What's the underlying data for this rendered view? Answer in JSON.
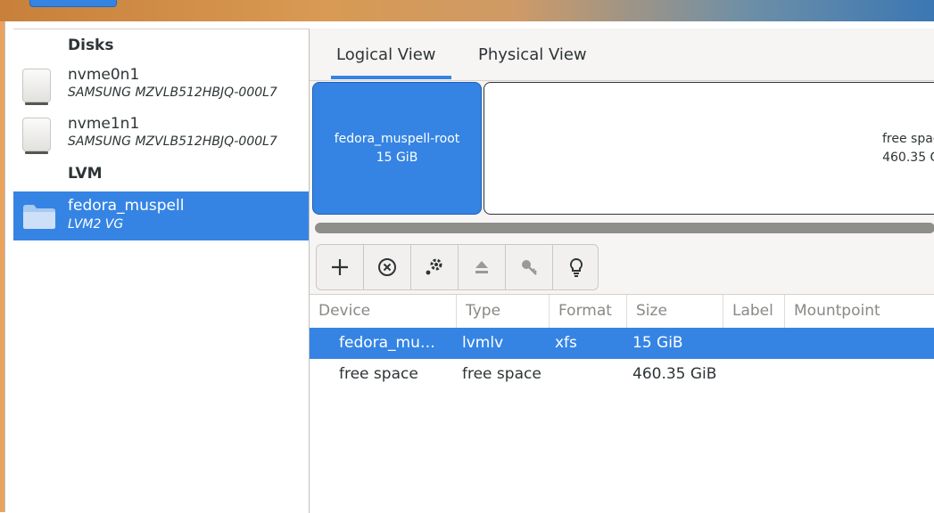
{
  "sidebar": {
    "disks_header": "Disks",
    "lvm_header": "LVM",
    "disks": [
      {
        "name": "nvme0n1",
        "model": "SAMSUNG MZVLB512HBJQ-000L7"
      },
      {
        "name": "nvme1n1",
        "model": "SAMSUNG MZVLB512HBJQ-000L7"
      }
    ],
    "volume_groups": [
      {
        "name": "fedora_muspell",
        "type": "LVM2 VG"
      }
    ]
  },
  "tabs": {
    "logical": "Logical View",
    "physical": "Physical View",
    "active": "Logical View"
  },
  "partition_map": {
    "root": {
      "name": "fedora_muspell-root",
      "size": "15 GiB"
    },
    "free": {
      "name": "free spac",
      "size": "460.35 G"
    }
  },
  "toolbar": {
    "icons": [
      "add-icon",
      "remove-icon",
      "configure-icon",
      "eject-icon",
      "key-icon",
      "lightbulb-icon"
    ]
  },
  "table": {
    "columns": [
      "Device",
      "Type",
      "Format",
      "Size",
      "Label",
      "Mountpoint"
    ],
    "rows": [
      {
        "device": "fedora_mu…",
        "type": "lvmlv",
        "format": "xfs",
        "size": "15 GiB",
        "label": "",
        "mountpoint": "",
        "selected": true
      },
      {
        "device": "free space",
        "type": "free space",
        "format": "",
        "size": "460.35 GiB",
        "label": "",
        "mountpoint": "",
        "selected": false
      }
    ]
  },
  "colors": {
    "accent": "#3584e4",
    "sidebar_bg": "#ffffff",
    "main_bg": "#f6f5f4"
  }
}
